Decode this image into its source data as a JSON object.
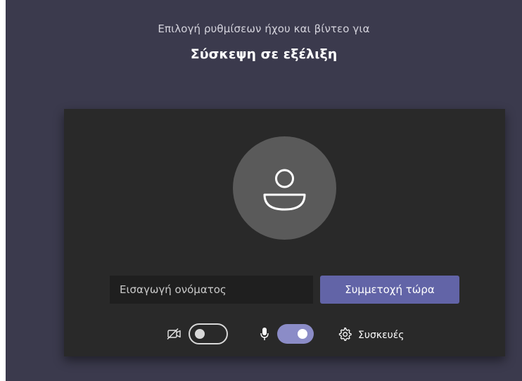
{
  "header": {
    "subtitle": "Επιλογή ρυθμίσεων ήχου και βίντεο για",
    "meeting_title": "Σύσκεψη σε εξέλιξη"
  },
  "prejoin": {
    "avatar_icon": "person-icon",
    "name_input": {
      "placeholder": "Εισαγωγή ονόματος",
      "value": ""
    },
    "join_button_label": "Συμμετοχή τώρα",
    "camera": {
      "icon": "camera-off-icon",
      "enabled": false
    },
    "microphone": {
      "icon": "microphone-icon",
      "enabled": true
    },
    "devices": {
      "icon": "gear-icon",
      "label": "Συσκευές"
    }
  },
  "colors": {
    "background": "#3b3a4d",
    "card": "#292929",
    "accent": "#6264a7",
    "toggle_on": "#8b8cc7",
    "avatar": "#5a5a5a",
    "input": "#1f1f1f"
  }
}
